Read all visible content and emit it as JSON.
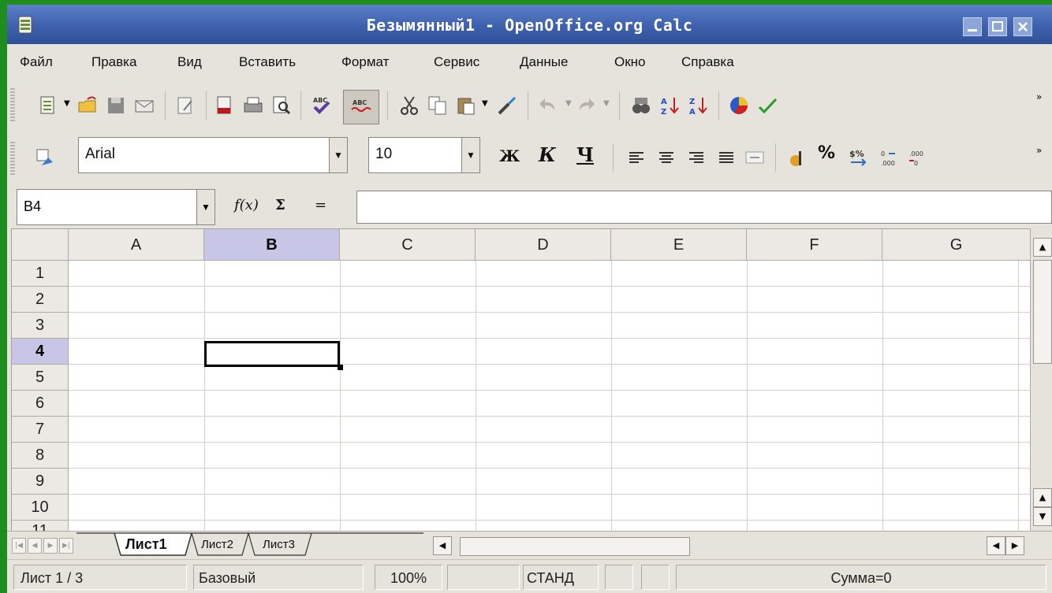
{
  "window": {
    "title": "Безымянный1 - OpenOffice.org Calc"
  },
  "menu": [
    "Файл",
    "Правка",
    "Вид",
    "Вставить",
    "Формат",
    "Сервис",
    "Данные",
    "Окно",
    "Справка"
  ],
  "format_toolbar": {
    "font_name": "Arial",
    "font_size": "10",
    "bold_label": "Ж",
    "italic_label": "К",
    "underline_label": "Ч",
    "percent_label": "%"
  },
  "formula_bar": {
    "cell_reference": "B4",
    "function_wizard_label": "f(x)",
    "sum_label": "Σ",
    "equals_label": "=",
    "formula_value": ""
  },
  "grid": {
    "columns": [
      "A",
      "B",
      "C",
      "D",
      "E",
      "F",
      "G"
    ],
    "rows": [
      "1",
      "2",
      "3",
      "4",
      "5",
      "6",
      "7",
      "8",
      "9",
      "10",
      "11"
    ],
    "selected_column": "B",
    "selected_row": "4"
  },
  "sheets": {
    "tabs": [
      "Лист1",
      "Лист2",
      "Лист3"
    ],
    "active": "Лист1"
  },
  "status": {
    "sheet": "Лист 1 / 3",
    "page_style": "Базовый",
    "zoom": "100%",
    "mode": "СТАНД",
    "sum": "Сумма=0"
  },
  "colors": {
    "titlebar": "#3f61ad",
    "selection_header": "#c8c6e6",
    "desktop": "#1e8c1e"
  }
}
